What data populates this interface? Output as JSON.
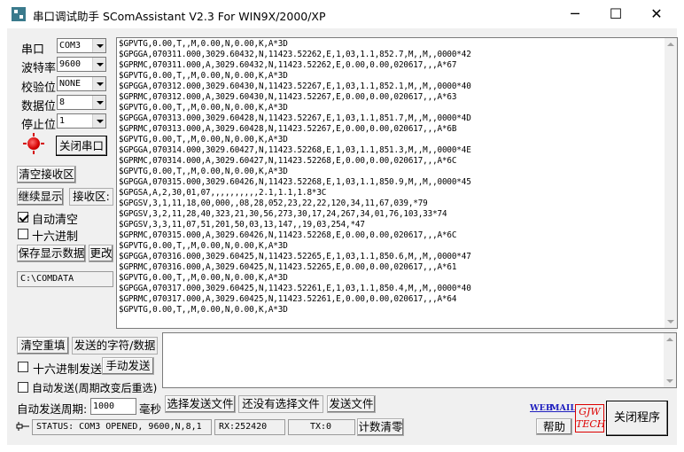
{
  "window": {
    "title": "串口调试助手 SComAssistant V2.3 For WIN9X/2000/XP"
  },
  "settings": {
    "port_label": "串口",
    "port_value": "COM3",
    "baud_label": "波特率",
    "baud_value": "9600",
    "parity_label": "校验位",
    "parity_value": "NONE",
    "databits_label": "数据位",
    "databits_value": "8",
    "stopbits_label": "停止位",
    "stopbits_value": "1"
  },
  "buttons": {
    "close_port": "关闭串口",
    "clear_receive": "清空接收区",
    "continue_display": "继续显示",
    "receive_area_label": "接收区:",
    "save_display": "保存显示数据",
    "change": "更改",
    "clear_resend": "清空重填",
    "send_chars": "发送的字符/数据",
    "manual_send": "手动发送",
    "select_file": "选择发送文件",
    "no_file": "还没有选择文件",
    "send_file": "发送文件",
    "count_clear": "计数清零",
    "help": "帮助",
    "close_program": "关闭程序"
  },
  "options": {
    "auto_clear": "自动清空",
    "auto_clear_checked": true,
    "hex_display": "十六进制",
    "hex_display_checked": false,
    "hex_send": "十六进制发送",
    "hex_send_checked": false,
    "auto_send": "自动发送(周期改变后重选)",
    "auto_send_checked": false,
    "period_label": "自动发送周期:",
    "period_value": "1000",
    "period_unit": "毫秒"
  },
  "save_path": "C:\\COMDATA",
  "receive": {
    "lines": [
      "$GPVTG,0.00,T,,M,0.00,N,0.00,K,A*3D",
      "$GPGGA,070311.000,3029.60432,N,11423.52262,E,1,03,1.1,852.7,M,,M,,0000*42",
      "$GPRMC,070311.000,A,3029.60432,N,11423.52262,E,0.00,0.00,020617,,,A*67",
      "$GPVTG,0.00,T,,M,0.00,N,0.00,K,A*3D",
      "$GPGGA,070312.000,3029.60430,N,11423.52267,E,1,03,1.1,852.1,M,,M,,0000*40",
      "$GPRMC,070312.000,A,3029.60430,N,11423.52267,E,0.00,0.00,020617,,,A*63",
      "$GPVTG,0.00,T,,M,0.00,N,0.00,K,A*3D",
      "$GPGGA,070313.000,3029.60428,N,11423.52267,E,1,03,1.1,851.7,M,,M,,0000*4D",
      "$GPRMC,070313.000,A,3029.60428,N,11423.52267,E,0.00,0.00,020617,,,A*6B",
      "$GPVTG,0.00,T,,M,0.00,N,0.00,K,A*3D",
      "$GPGGA,070314.000,3029.60427,N,11423.52268,E,1,03,1.1,851.3,M,,M,,0000*4E",
      "$GPRMC,070314.000,A,3029.60427,N,11423.52268,E,0.00,0.00,020617,,,A*6C",
      "$GPVTG,0.00,T,,M,0.00,N,0.00,K,A*3D",
      "$GPGGA,070315.000,3029.60426,N,11423.52268,E,1,03,1.1,850.9,M,,M,,0000*45",
      "$GPGSA,A,2,30,01,07,,,,,,,,,,2.1,1.1,1.8*3C",
      "$GPGSV,3,1,11,18,00,000,,08,28,052,23,22,22,120,34,11,67,039,*79",
      "$GPGSV,3,2,11,28,40,323,21,30,56,273,30,17,24,267,34,01,76,103,33*74",
      "$GPGSV,3,3,11,07,51,201,50,03,13,147,,19,03,254,*47",
      "$GPRMC,070315.000,A,3029.60426,N,11423.52268,E,0.00,0.00,020617,,,A*6C",
      "$GPVTG,0.00,T,,M,0.00,N,0.00,K,A*3D",
      "$GPGGA,070316.000,3029.60425,N,11423.52265,E,1,03,1.1,850.6,M,,M,,0000*47",
      "$GPRMC,070316.000,A,3029.60425,N,11423.52265,E,0.00,0.00,020617,,,A*61",
      "$GPVTG,0.00,T,,M,0.00,N,0.00,K,A*3D",
      "$GPGGA,070317.000,3029.60425,N,11423.52261,E,1,03,1.1,850.4,M,,M,,0000*40",
      "$GPRMC,070317.000,A,3029.60425,N,11423.52261,E,0.00,0.00,020617,,,A*64",
      "$GPVTG,0.00,T,,M,0.00,N,0.00,K,A*3D"
    ]
  },
  "status": {
    "main": "STATUS: COM3 OPENED, 9600,N,8,1",
    "rx": "RX:252420",
    "tx": "TX:0"
  },
  "links": {
    "web": "WEB",
    "mail": "MAIL"
  },
  "logo": {
    "line1": "GJW",
    "line2": "TECH"
  }
}
